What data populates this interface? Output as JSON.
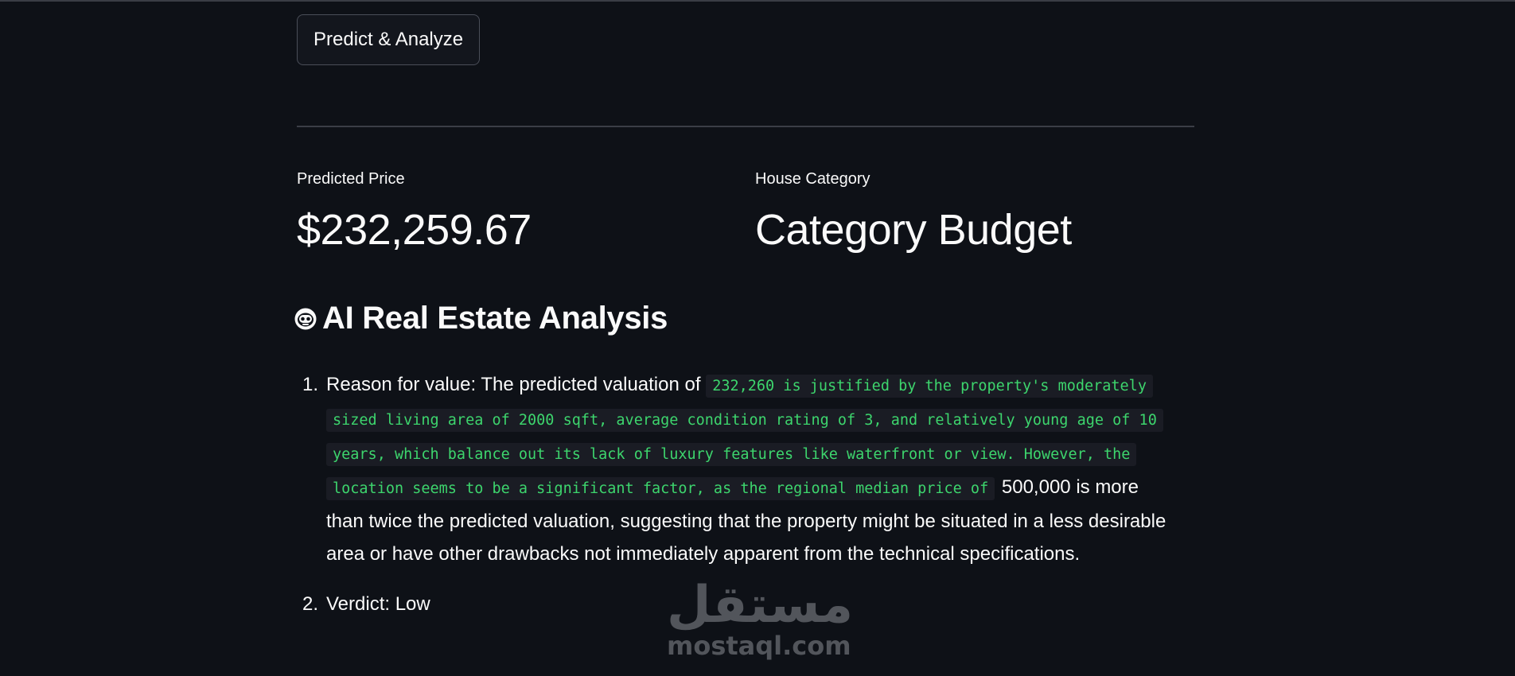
{
  "actions": {
    "predict_button": "Predict & Analyze"
  },
  "metrics": {
    "price": {
      "label": "Predicted Price",
      "value": "$232,259.67"
    },
    "category": {
      "label": "House Category",
      "value": "Category Budget"
    }
  },
  "analysis": {
    "icon": "robot-icon",
    "title": "AI Real Estate Analysis",
    "items": [
      {
        "number": "1.",
        "text_before": "Reason for value: The predicted valuation of",
        "code": "232,260 is justified by the property's moderately sized living area of 2000 sqft, average condition rating of 3, and relatively young age of 10 years, which balance out its lack of luxury features like waterfront or view. However, the location seems to be a significant factor, as the regional median price of",
        "text_after": "500,000 is more than twice the predicted valuation, suggesting that the property might be situated in a less desirable area or have other drawbacks not immediately apparent from the technical specifications."
      },
      {
        "number": "2.",
        "text": "Verdict: Low"
      }
    ]
  },
  "watermark": {
    "arabic": "مستقل",
    "latin": "mostaql.com"
  },
  "colors": {
    "background": "#0e1117",
    "text": "#fafafa",
    "code_text": "#3dd56d",
    "code_bg": "#1a1c24",
    "border": "#4a4e58"
  }
}
